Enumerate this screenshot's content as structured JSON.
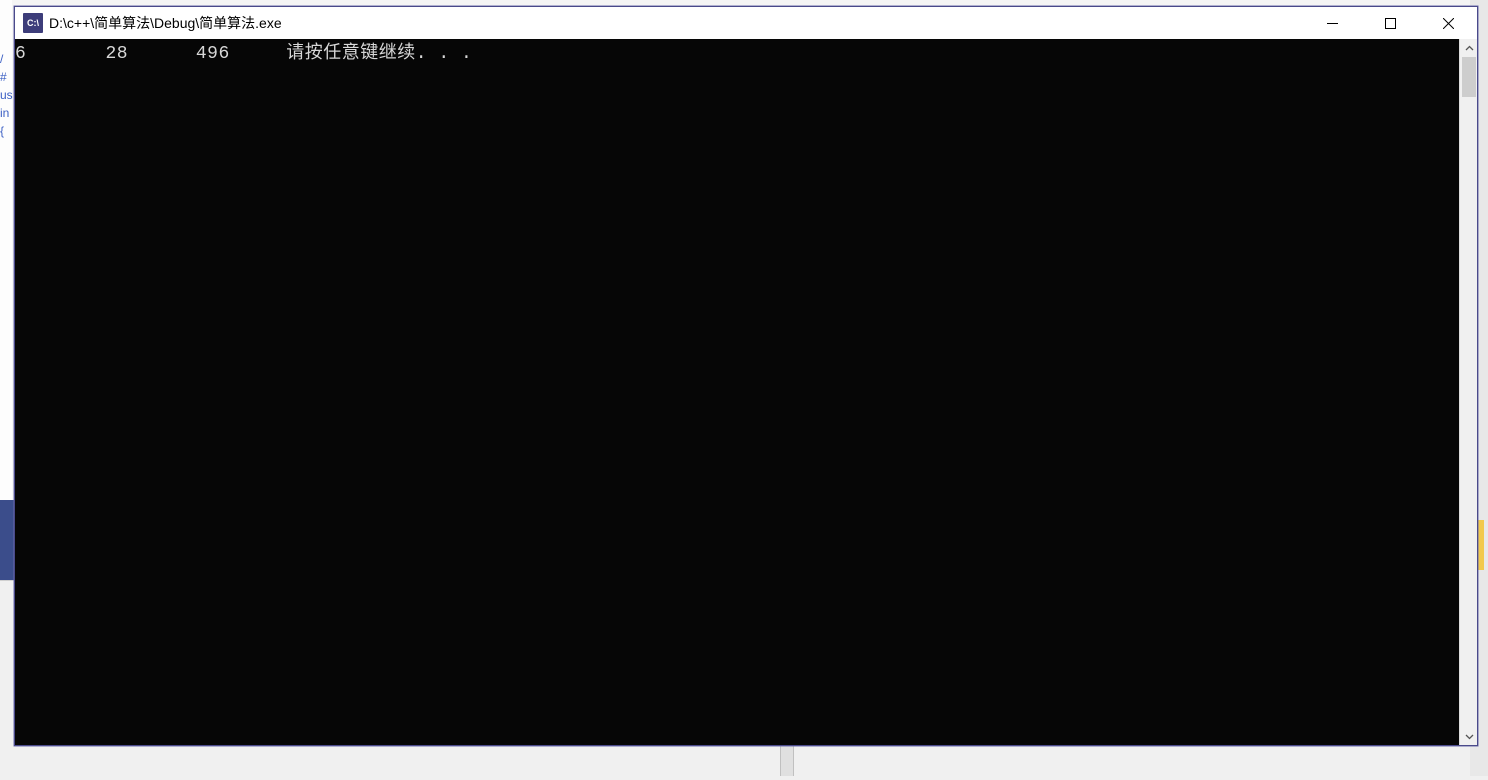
{
  "window": {
    "icon_label": "C:\\",
    "title": "D:\\c++\\简单算法\\Debug\\简单算法.exe"
  },
  "console": {
    "line1_num1": "6",
    "line1_num2": "28",
    "line1_num3": "496",
    "line1_msg": "请按任意键继续. . ."
  },
  "bg_code": {
    "l1": "/",
    "l2": "#",
    "l3": "us",
    "l4": "in",
    "l5": "{"
  }
}
